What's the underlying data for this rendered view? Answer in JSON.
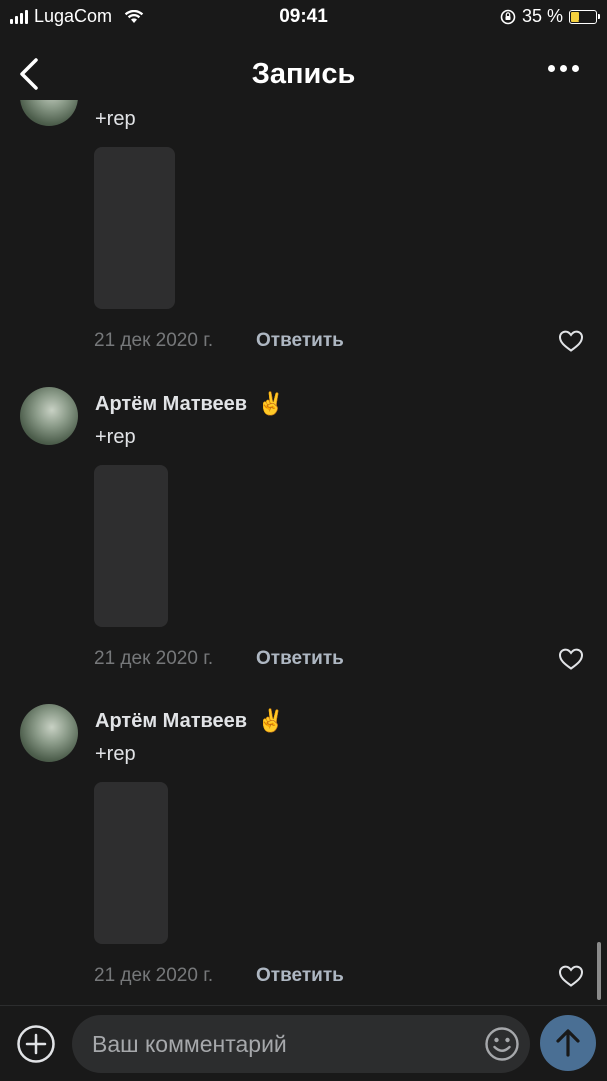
{
  "status_bar": {
    "carrier": "LugaCom",
    "time": "09:41",
    "battery": "35 %",
    "battery_level": 0.35
  },
  "nav": {
    "title": "Запись",
    "back_icon": "chevron-left-icon",
    "more_icon": "ellipsis-icon"
  },
  "comments": [
    {
      "author": "",
      "text": "+rep",
      "date": "21 дек 2020 г.",
      "reply_label": "Ответить"
    },
    {
      "author": "Артём Матвеев",
      "emoji": "✌️",
      "text": "+rep",
      "date": "21 дек 2020 г.",
      "reply_label": "Ответить"
    },
    {
      "author": "Артём Матвеев",
      "emoji": "✌️",
      "text": "+rep",
      "date": "21 дек 2020 г.",
      "reply_label": "Ответить"
    }
  ],
  "composer": {
    "placeholder": "Ваш комментарий",
    "add_icon": "plus-circle-icon",
    "emoji_icon": "smiley-icon",
    "send_icon": "arrow-up-icon"
  },
  "colors": {
    "background": "#191919",
    "accent": "#4a6f94",
    "secondary_text": "#76787a",
    "link_text": "#aeb7c2"
  }
}
